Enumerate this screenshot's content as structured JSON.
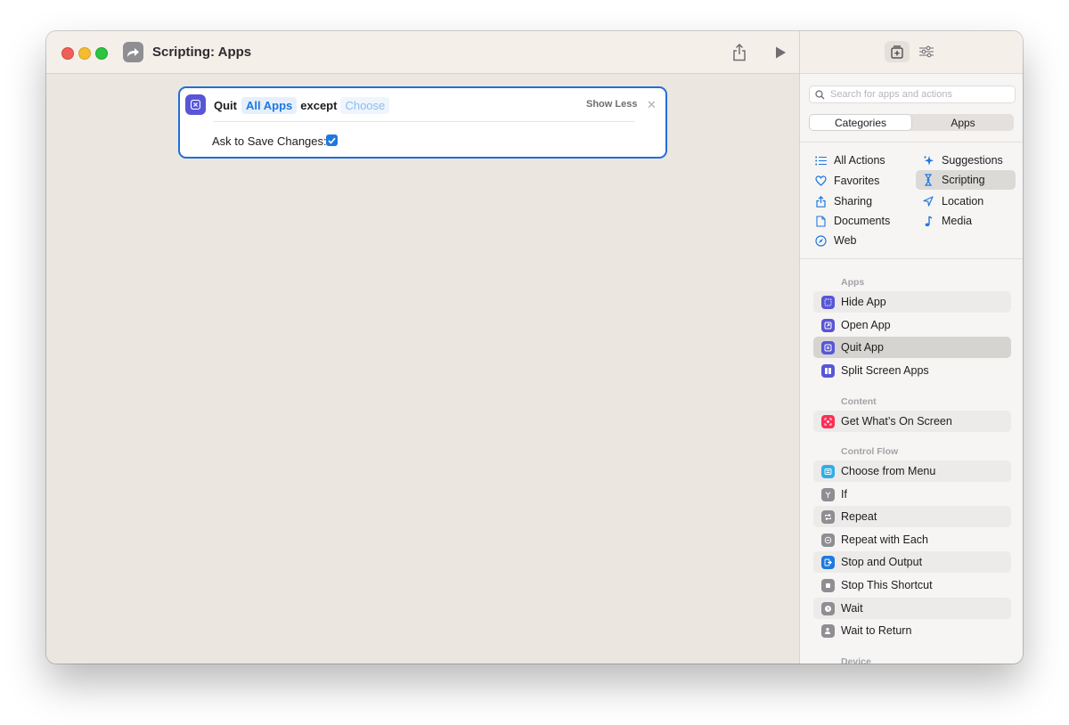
{
  "window": {
    "title": "Scripting: Apps"
  },
  "action_card": {
    "verb": "Quit",
    "target": "All Apps",
    "connector": "except",
    "choose_placeholder": "Choose",
    "show_less": "Show Less",
    "ask_label": "Ask to Save Changes:",
    "ask_checked": true
  },
  "sidebar": {
    "search_placeholder": "Search for apps and actions",
    "segments": [
      "Categories",
      "Apps"
    ],
    "active_segment": "Categories",
    "categories": [
      {
        "label": "All Actions",
        "icon": "list-icon"
      },
      {
        "label": "Suggestions",
        "icon": "sparkle-icon"
      },
      {
        "label": "Favorites",
        "icon": "heart-icon"
      },
      {
        "label": "Scripting",
        "icon": "scripting-icon"
      },
      {
        "label": "Sharing",
        "icon": "share-icon"
      },
      {
        "label": "Location",
        "icon": "location-arrow-icon"
      },
      {
        "label": "Documents",
        "icon": "document-icon"
      },
      {
        "label": "Media",
        "icon": "music-note-icon"
      },
      {
        "label": "Web",
        "icon": "compass-icon"
      }
    ],
    "selected_category": "Scripting",
    "groups": [
      {
        "title": "Apps",
        "items": [
          "Hide App",
          "Open App",
          "Quit App",
          "Split Screen Apps"
        ]
      },
      {
        "title": "Content",
        "items": [
          "Get What’s On Screen"
        ]
      },
      {
        "title": "Control Flow",
        "items": [
          "Choose from Menu",
          "If",
          "Repeat",
          "Repeat with Each",
          "Stop and Output",
          "Stop This Shortcut",
          "Wait",
          "Wait to Return"
        ]
      },
      {
        "title": "Device",
        "items": []
      }
    ],
    "selected_action": "Quit App"
  },
  "colors": {
    "accent": "#1f78e0",
    "apps_icon": "#5856d6",
    "content_icon": "#ff2d55",
    "menu_icon": "#32ade6",
    "control_icon": "#8e8e93",
    "canvas": "#ebe6e0"
  }
}
